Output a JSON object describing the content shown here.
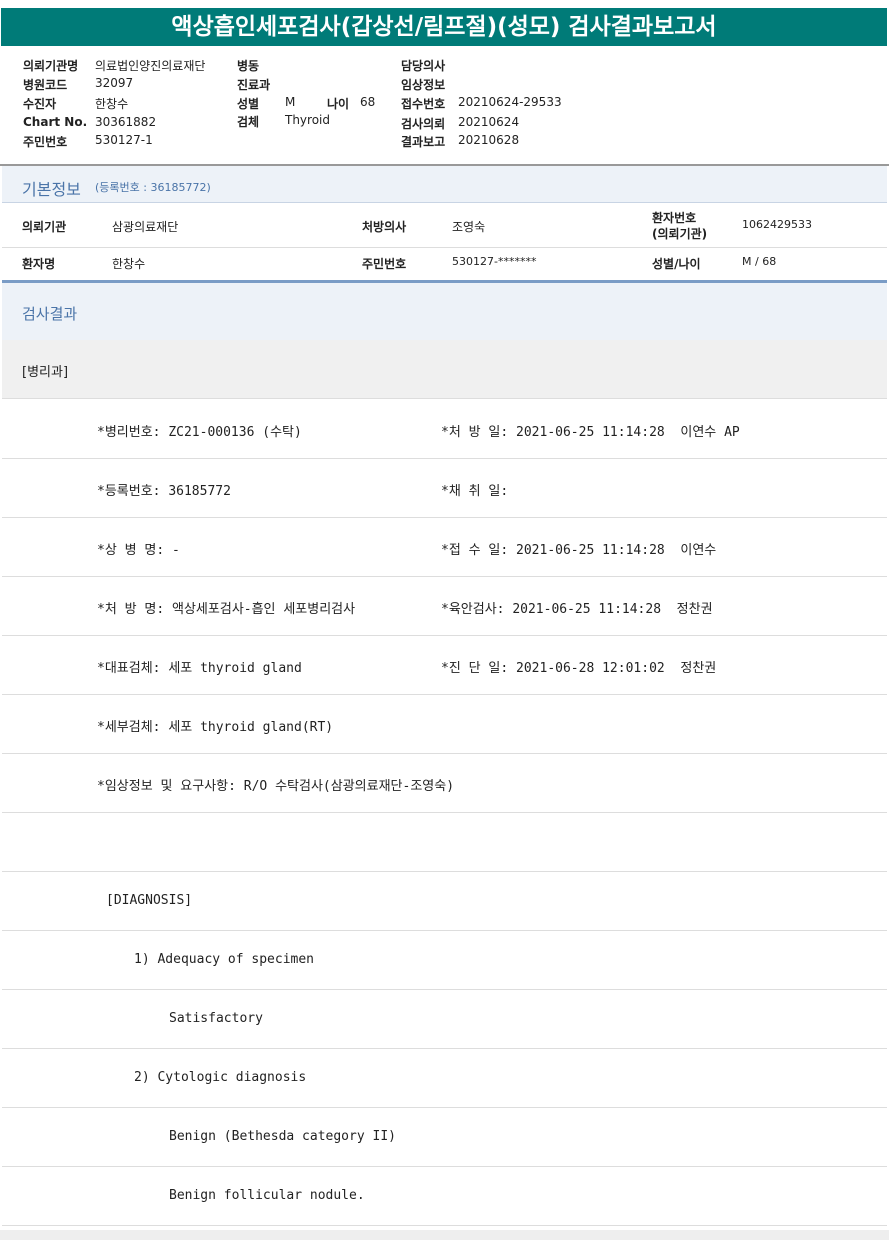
{
  "title": "액상흡인세포검사(갑상선/림프절)(성모) 검사결과보고서",
  "header": {
    "institution_label": "의뢰기관명",
    "institution": "의료법인양진의료재단",
    "hospital_code_label": "병원코드",
    "hospital_code": "32097",
    "patient_label": "수진자",
    "patient": "한창수",
    "chart_label": "Chart No.",
    "chart": "30361882",
    "rrn_label": "주민번호",
    "rrn": "530127-1",
    "ward_label": "병동",
    "dept_label": "진료과",
    "sex_label": "성별",
    "sex": "M",
    "age_label": "나이",
    "age": "68",
    "specimen_label": "검체",
    "specimen": "Thyroid",
    "doctor_label": "담당의사",
    "clinical_label": "임상정보",
    "receipt_label": "접수번호",
    "receipt": "20210624-29533",
    "request_label": "검사의뢰",
    "request": "20210624",
    "report_label": "결과보고",
    "report": "20210628"
  },
  "basic": {
    "title": "기본정보",
    "reg": "(등록번호 : 36185772)",
    "inst_label": "의뢰기관",
    "inst": "삼광의료재단",
    "presc_label": "처방의사",
    "presc": "조영숙",
    "pno_label1": "환자번호",
    "pno_label2": "(의뢰기관)",
    "pno": "1062429533",
    "name_label": "환자명",
    "name": "한창수",
    "rrn_label": "주민번호",
    "rrn": "530127-*******",
    "sexage_label": "성별/나이",
    "sexage": "M / 68"
  },
  "results": {
    "title": "검사결과",
    "dept": "[병리과]",
    "rows": [
      {
        "left": "*병리번호: ZC21-000136 (수탁)",
        "right": "*처 방 일: 2021-06-25 11:14:28  이연수 AP"
      },
      {
        "left": "*등록번호: 36185772",
        "right": "*채 취 일:"
      },
      {
        "left": "*상 병 명: -",
        "right": "*접 수 일: 2021-06-25 11:14:28  이연수"
      },
      {
        "left": "*처 방 명: 액상세포검사-흡인 세포병리검사",
        "right": "*육안검사: 2021-06-25 11:14:28  정찬권"
      },
      {
        "left": "*대표검체: 세포 thyroid gland",
        "right": "*진 단 일: 2021-06-28 12:01:02  정찬권"
      },
      {
        "left": "*세부검체: 세포 thyroid gland(RT)",
        "right": ""
      },
      {
        "left": "*임상정보 및 요구사항: R/O 수탁검사(삼광의료재단-조영숙)",
        "right": ""
      },
      {
        "left": "",
        "right": ""
      }
    ],
    "diagnosis": [
      "[DIAGNOSIS]",
      "1) Adequacy of specimen",
      "Satisfactory",
      "2) Cytologic diagnosis",
      "Benign (Bethesda category II)",
      "Benign follicular nodule."
    ]
  }
}
